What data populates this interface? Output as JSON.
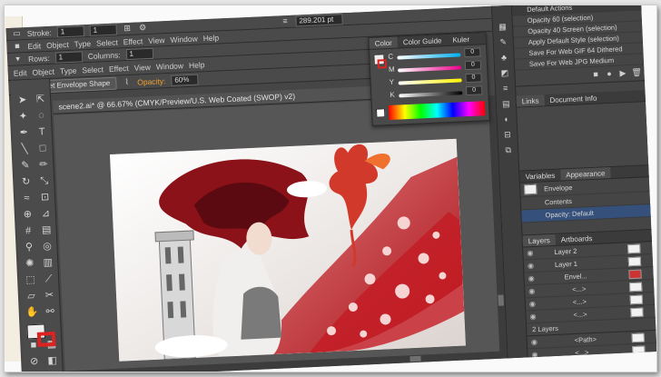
{
  "toolbar_top": {
    "stroke_label": "Stroke:",
    "stroke_value": "1",
    "weight_value": "1",
    "opacity_label": "Opacity:",
    "opacity_value": "60%",
    "width_value": "289.201 pt"
  },
  "menu": {
    "items": [
      "Edit",
      "Object",
      "Type",
      "Select",
      "Effect",
      "View",
      "Window",
      "Help"
    ],
    "secondary_items": [
      "Edit",
      "Object",
      "Type",
      "Select",
      "Effect",
      "View",
      "Window",
      "Help"
    ]
  },
  "toolbar_controls": {
    "rows_label": "Rows:",
    "rows_value": "1",
    "columns_label": "Columns:",
    "columns_value": "1",
    "reset_envelope_label": "Reset Envelope Shape",
    "opacity_label": "Opacity:",
    "opacity_value": "60%"
  },
  "document": {
    "tab_title": "scene2.ai* @ 66.67% (CMYK/Preview/U.S. Web Coated (SWOP) v2)"
  },
  "color_panel": {
    "tabs": [
      "Color",
      "Color Guide",
      "Kuler"
    ],
    "sliders": [
      {
        "label": "C",
        "value": "0",
        "color": "#00aeef"
      },
      {
        "label": "M",
        "value": "0",
        "color": "#ec008c"
      },
      {
        "label": "Y",
        "value": "0",
        "color": "#fff200"
      },
      {
        "label": "K",
        "value": "0",
        "color": "#000000"
      }
    ]
  },
  "actions_panel": {
    "title": "Default Actions",
    "items": [
      "Opacity 60 (selection)",
      "Opacity 40 Screen (selection)",
      "Apply Default Style (selection)",
      "Save For Web GIF 64 Dithered",
      "Save For Web JPG Medium"
    ]
  },
  "links_panel": {
    "tabs": [
      "Links",
      "Document Info"
    ]
  },
  "appearance_panel": {
    "tabs": [
      "Variables",
      "Appearance"
    ],
    "items": [
      "Envelope",
      "Contents",
      "Opacity: Default"
    ]
  },
  "layers_panel": {
    "tabs": [
      "Layers",
      "Artboards"
    ],
    "rows": [
      "Layer 2",
      "Layer 1",
      "Envel...",
      "<...>",
      "<...>",
      "<...>"
    ],
    "footer_count": "2 Layers",
    "lower_rows": [
      "<Path>",
      "<...>",
      "<...>",
      "<...>"
    ]
  },
  "colors": {
    "app_bg": "#464646",
    "panel_bg": "#454545",
    "accent_red": "#c8272c",
    "artboard_bg": "#eae7e4"
  }
}
